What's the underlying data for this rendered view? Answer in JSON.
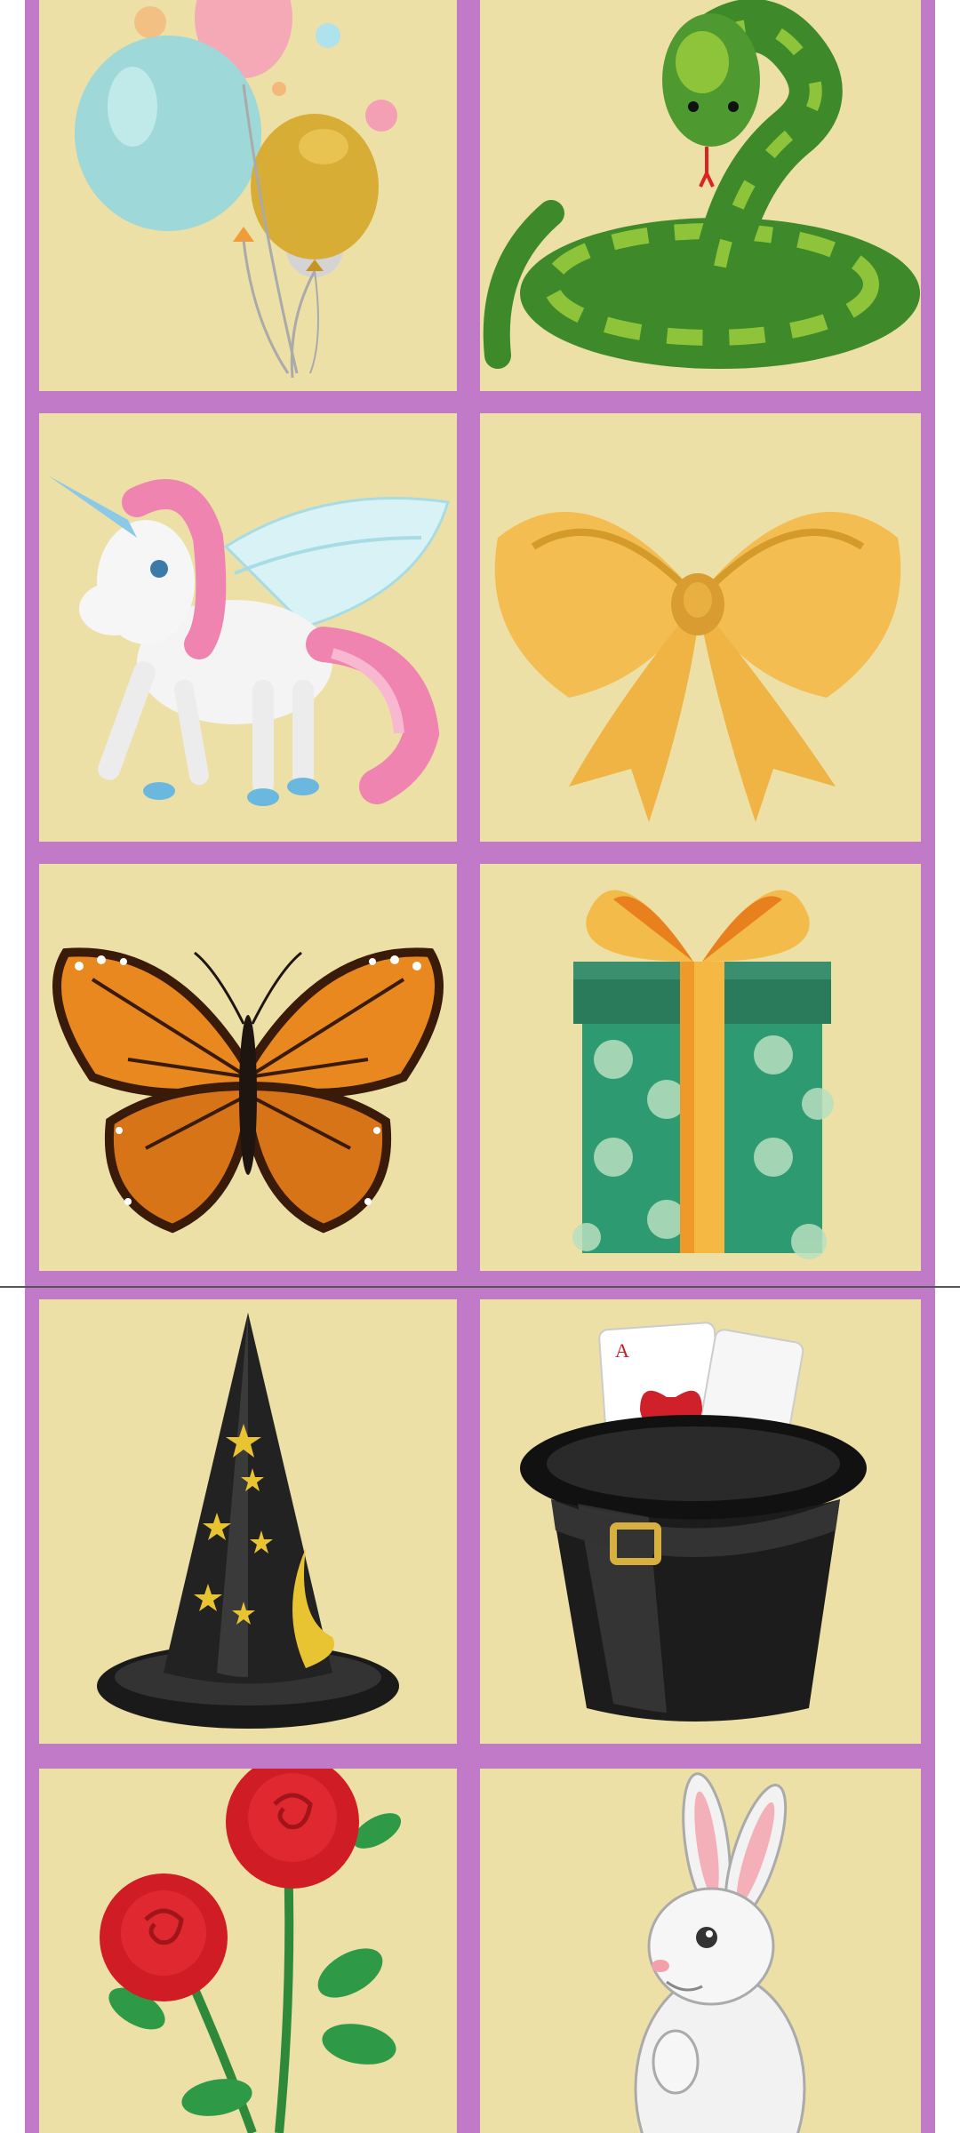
{
  "palette": {
    "frame": "#c07ac8",
    "card": "#ece0a6",
    "divider": "#555555"
  },
  "grid": {
    "columns": 2,
    "rows": 5,
    "cards": [
      {
        "icon": "balloons-icon"
      },
      {
        "icon": "snake-icon"
      },
      {
        "icon": "unicorn-icon"
      },
      {
        "icon": "bow-icon"
      },
      {
        "icon": "butterfly-icon"
      },
      {
        "icon": "gift-box-icon"
      },
      {
        "icon": "witch-hat-icon"
      },
      {
        "icon": "magic-top-hat-icon"
      },
      {
        "icon": "roses-icon"
      },
      {
        "icon": "bunny-icon"
      }
    ]
  }
}
